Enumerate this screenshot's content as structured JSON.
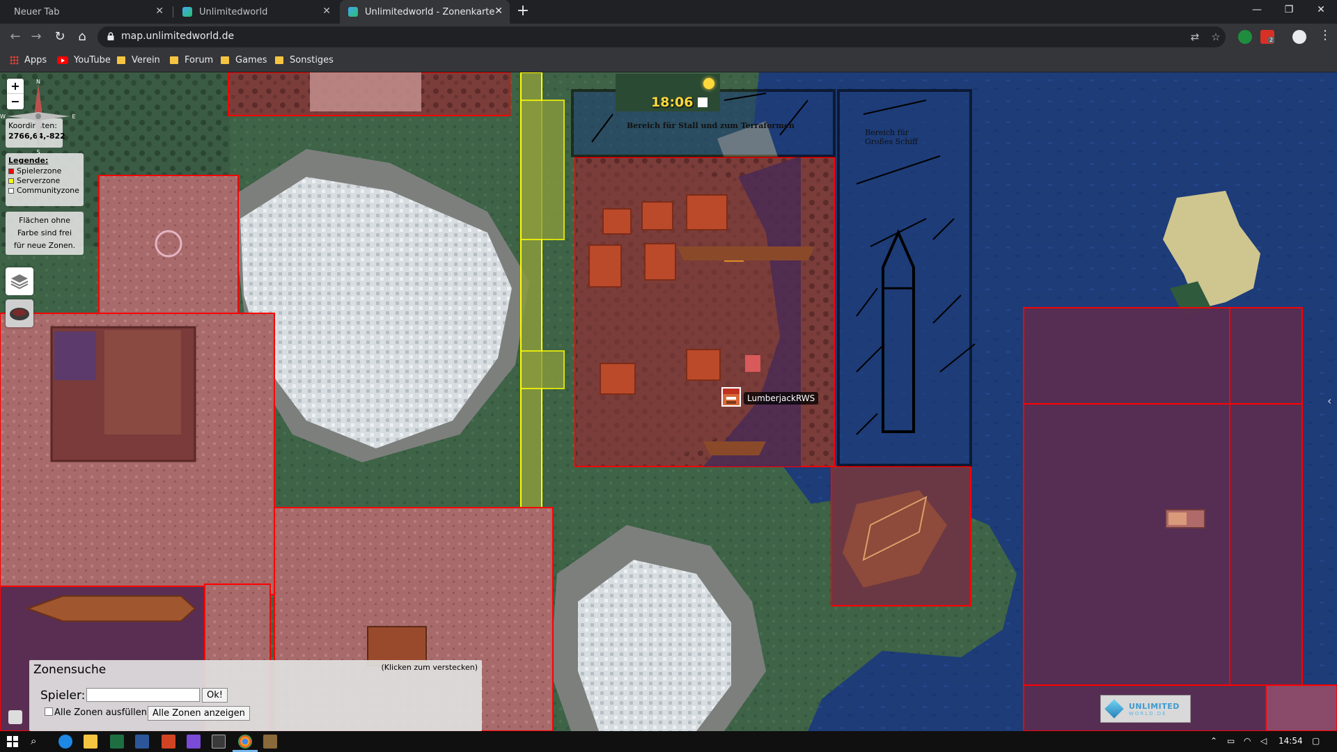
{
  "browser": {
    "tabs": [
      {
        "label": "Neuer Tab",
        "active": false
      },
      {
        "label": "Unlimitedworld",
        "active": false
      },
      {
        "label": "Unlimitedworld - Zonenkarte",
        "active": true
      }
    ],
    "url": "map.unlimitedworld.de",
    "bookmarks": [
      "Apps",
      "YouTube",
      "Verein",
      "Forum",
      "Games",
      "Sonstiges"
    ],
    "adblock_count": "2"
  },
  "map": {
    "coordinates_label": "Koordinaten:",
    "coordinates_value": "2766,64,-822",
    "legend_title": "Legende:",
    "legend": [
      {
        "label": "Spielerzone",
        "color": "#ff0000"
      },
      {
        "label": "Serverzone",
        "color": "#ffff00"
      },
      {
        "label": "Communityzone",
        "color": "#ffffff"
      }
    ],
    "free_note": [
      "Flächen ohne",
      "Farbe sind frei",
      "für neue Zonen."
    ],
    "clock": "18:06",
    "zone_note_stall": "Bereich für Stall und zum Terraformen",
    "zone_note_ship": [
      "Bereich für",
      "Großes Schiff"
    ],
    "player_name": "LumberjackRWS",
    "compass": {
      "n": "N",
      "e": "E",
      "s": "S",
      "w": "W"
    }
  },
  "zonensuche": {
    "title": "Zonensuche",
    "hide_hint": "(Klicken zum verstecken)",
    "player_label": "Spieler:",
    "player_value": "",
    "ok_label": "Ok!",
    "fill_all_label": "Alle Zonen ausfüllen",
    "show_all_label": "Alle Zonen anzeigen"
  },
  "logo": {
    "line1": "UNLIMITED",
    "line2": "WORLD.DE"
  },
  "taskbar": {
    "time": "14:54"
  },
  "colors": {
    "player_zone": "#ff0000",
    "server_zone": "#ffff00",
    "community_zone": "#ffffff",
    "water": "#1c3a74"
  }
}
